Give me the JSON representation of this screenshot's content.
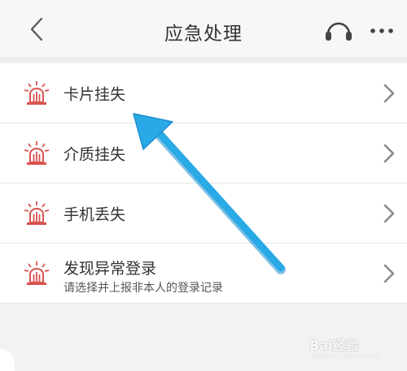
{
  "header": {
    "title": "应急处理",
    "back_icon": "chevron-left-icon",
    "support_icon": "headset-icon",
    "more_icon": "more-dots-icon"
  },
  "list": {
    "items": [
      {
        "label": "卡片挂失",
        "sublabel": "",
        "icon": "alarm-light-icon"
      },
      {
        "label": "介质挂失",
        "sublabel": "",
        "icon": "alarm-light-icon"
      },
      {
        "label": "手机丢失",
        "sublabel": "",
        "icon": "alarm-light-icon"
      },
      {
        "label": "发现异常登录",
        "sublabel": "请选择并上报非本人的登录记录",
        "icon": "alarm-light-icon"
      }
    ]
  },
  "colors": {
    "icon_red": "#d9534f",
    "chevron": "#8a8a8e",
    "arrow": "#29a9e6",
    "background": "#f2f2f4"
  },
  "watermark": {
    "text": "Bai经验",
    "sub": "jingyan.baidu.com"
  }
}
